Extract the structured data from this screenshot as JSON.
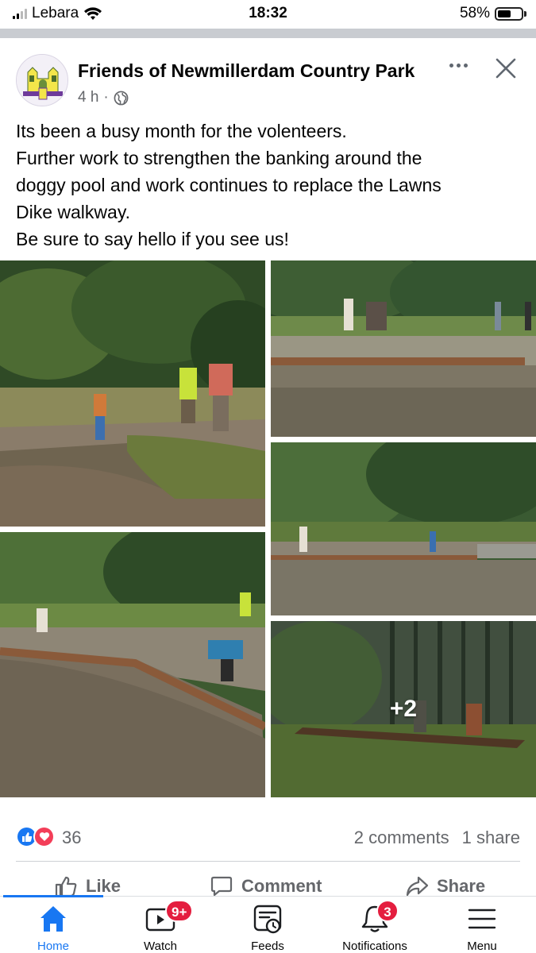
{
  "status_bar": {
    "carrier": "Lebara",
    "time": "18:32",
    "battery": "58%",
    "battery_level": 0.58
  },
  "post": {
    "page_name": "Friends of Newmillerdam Country Park",
    "time_ago": "4 h",
    "separator": "·",
    "audience_icon": "globe-icon",
    "text_lines": [
      "Its been a busy month for the volenteers.",
      "Further work to strengthen the banking around the",
      "doggy pool and work continues to replace the Lawns",
      "Dike walkway.",
      "Be sure to say hello if you see us!"
    ],
    "more_photos": "+2"
  },
  "engagement": {
    "reactions": [
      "like-icon",
      "love-icon"
    ],
    "reaction_count": "36",
    "comments": "2 comments",
    "shares": "1 share"
  },
  "actions": {
    "like": "Like",
    "comment": "Comment",
    "share": "Share"
  },
  "nav": {
    "home": "Home",
    "watch": "Watch",
    "watch_badge": "9+",
    "feeds": "Feeds",
    "notifications": "Notifications",
    "notifications_badge": "3",
    "menu": "Menu"
  },
  "colors": {
    "accent": "#1877f2",
    "badge": "#e41e3f",
    "love": "#f33e58"
  }
}
